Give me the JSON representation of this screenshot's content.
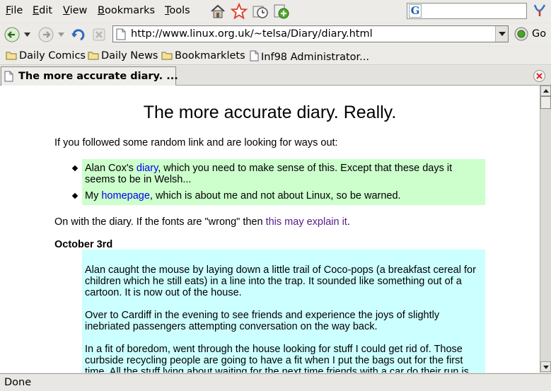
{
  "menubar": {
    "items": [
      {
        "mnemonic": "F",
        "rest": "ile"
      },
      {
        "mnemonic": "E",
        "rest": "dit"
      },
      {
        "mnemonic": "V",
        "rest": "iew"
      },
      {
        "mnemonic": "B",
        "rest": "ookmarks"
      },
      {
        "mnemonic": "T",
        "rest": "ools"
      }
    ],
    "search_logo": "G"
  },
  "navbar": {
    "url": "http://www.linux.org.uk/~telsa/Diary/diary.html",
    "go_label": "Go"
  },
  "bookmarks": [
    {
      "label": "Daily Comics",
      "icon": "folder-icon"
    },
    {
      "label": "Daily News",
      "icon": "folder-icon"
    },
    {
      "label": "Bookmarklets",
      "icon": "folder-icon"
    },
    {
      "label": "Inf98 Administrator...",
      "icon": "page-icon"
    }
  ],
  "tab": {
    "title": "The more accurate diary. ..."
  },
  "page": {
    "title": "The more accurate diary. Really.",
    "intro": "If you followed some random link and are looking for ways out:",
    "links": {
      "item1_pre": "Alan Cox's ",
      "item1_link": "diary",
      "item1_post_line1": ", which you need to make sense of this. Except that these days it",
      "item1_line2": "seems to be in Welsh...",
      "item2_pre": "My ",
      "item2_link": "homepage",
      "item2_post": ", which is about me and not about Linux, so be warned."
    },
    "fonts_pre": "On with the diary. If the fonts are \"wrong\" then ",
    "fonts_link": "this may explain it",
    "fonts_post": ".",
    "date": "October 3rd",
    "paragraphs": {
      "p1_l1": "Alan caught the mouse by laying down a little trail of Coco-pops (a breakfast cereal for",
      "p1_l2": "children which he still eats) in a line into the trap. It sounded like something out of a",
      "p1_l3": "cartoon. It is now out of the house.",
      "p2_l1": "Over to Cardiff in the evening to see friends and experience the joys of slightly",
      "p2_l2": "inebriated passengers attempting conversation on the way back.",
      "p3_l1": "In a fit of boredom, went through the house looking for stuff I could get rid of. Those",
      "p3_l2": "curbside recycling people are going to have a fit when I put the bags out for the first",
      "p3_l3": "time. All the stuff lying about waiting for the next time friends with a car do their run is"
    }
  },
  "status": {
    "text": "Done"
  },
  "colors": {
    "links_box": "#ccffcc",
    "entry_box": "#ccffff",
    "link": "#0000ee",
    "visited_link": "#551a8b"
  }
}
